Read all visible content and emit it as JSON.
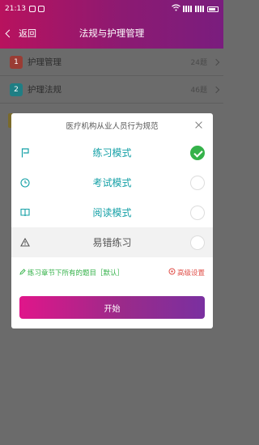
{
  "status_bar": {
    "time": "21:13"
  },
  "nav": {
    "back_label": "返回",
    "title": "法规与护理管理"
  },
  "list": [
    {
      "num": "1",
      "label": "护理管理",
      "count": "24题",
      "color": "#c0392b"
    },
    {
      "num": "2",
      "label": "护理法规",
      "count": "46题",
      "color": "#1aa6b0"
    }
  ],
  "dialog": {
    "title": "医疗机构从业人员行为规范",
    "modes": [
      {
        "label": "练习模式",
        "icon": "flag-icon",
        "selected": true
      },
      {
        "label": "考试模式",
        "icon": "clock-icon",
        "selected": false
      },
      {
        "label": "阅读模式",
        "icon": "book-icon",
        "selected": false
      },
      {
        "label": "易错练习",
        "icon": "warning-icon",
        "selected": false
      }
    ],
    "option_left": "练习章节下所有的题目［默认］",
    "option_right": "高级设置",
    "start_label": "开始"
  },
  "colors": {
    "accent": "#14a0a6",
    "brand": "#b8125e",
    "selected": "#35b24a",
    "settings": "#e0504a"
  }
}
